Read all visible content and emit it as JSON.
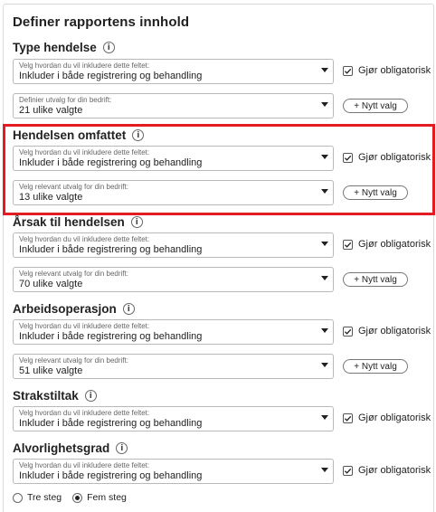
{
  "title": "Definer rapportens innhold",
  "info_glyph": "i",
  "caret_icon": "caret-down-icon",
  "check_icon": "checkmark-icon",
  "highlight_color": "#e31b23",
  "sections": [
    {
      "heading": "Type hendelse",
      "include": {
        "caption": "Velg hvordan du vil inkludere dette feltet:",
        "value": "Inkluder i både registrering og behandling"
      },
      "mandatory": {
        "label": "Gjør obligatorisk",
        "checked": true
      },
      "selection": {
        "caption": "Definier utvalg for din bedrift:",
        "value": "21 ulike valgte"
      },
      "new_option_label": "+ Nytt valg"
    },
    {
      "heading": "Hendelsen omfattet",
      "include": {
        "caption": "Velg hvordan du vil inkludere dette feltet:",
        "value": "Inkluder i både registrering og behandling"
      },
      "mandatory": {
        "label": "Gjør obligatorisk",
        "checked": true
      },
      "selection": {
        "caption": "Velg relevant utvalg for din bedrift:",
        "value": "13 ulike valgte"
      },
      "new_option_label": "+ Nytt valg",
      "highlighted": true
    },
    {
      "heading": "Årsak til hendelsen",
      "include": {
        "caption": "Velg hvordan du vil inkludere dette feltet:",
        "value": "Inkluder i både registrering og behandling"
      },
      "mandatory": {
        "label": "Gjør obligatorisk",
        "checked": true
      },
      "selection": {
        "caption": "Velg relevant utvalg for din bedrift:",
        "value": "70 ulike valgte"
      },
      "new_option_label": "+ Nytt valg"
    },
    {
      "heading": "Arbeidsoperasjon",
      "include": {
        "caption": "Velg hvordan du vil inkludere dette feltet:",
        "value": "Inkluder i både registrering og behandling"
      },
      "mandatory": {
        "label": "Gjør obligatorisk",
        "checked": true
      },
      "selection": {
        "caption": "Velg relevant utvalg for din bedrift:",
        "value": "51 ulike valgte"
      },
      "new_option_label": "+ Nytt valg"
    },
    {
      "heading": "Strakstiltak",
      "include": {
        "caption": "Velg hvordan du vil inkludere dette feltet:",
        "value": "Inkluder i både registrering og behandling"
      },
      "mandatory": {
        "label": "Gjør obligatorisk",
        "checked": true
      }
    },
    {
      "heading": "Alvorlighetsgrad",
      "include": {
        "caption": "Velg hvordan du vil inkludere dette feltet:",
        "value": "Inkluder i både registrering og behandling"
      },
      "mandatory": {
        "label": "Gjør obligatorisk",
        "checked": true
      },
      "severity_options": [
        {
          "label": "Tre steg",
          "selected": false
        },
        {
          "label": "Fem steg",
          "selected": true
        }
      ]
    }
  ]
}
